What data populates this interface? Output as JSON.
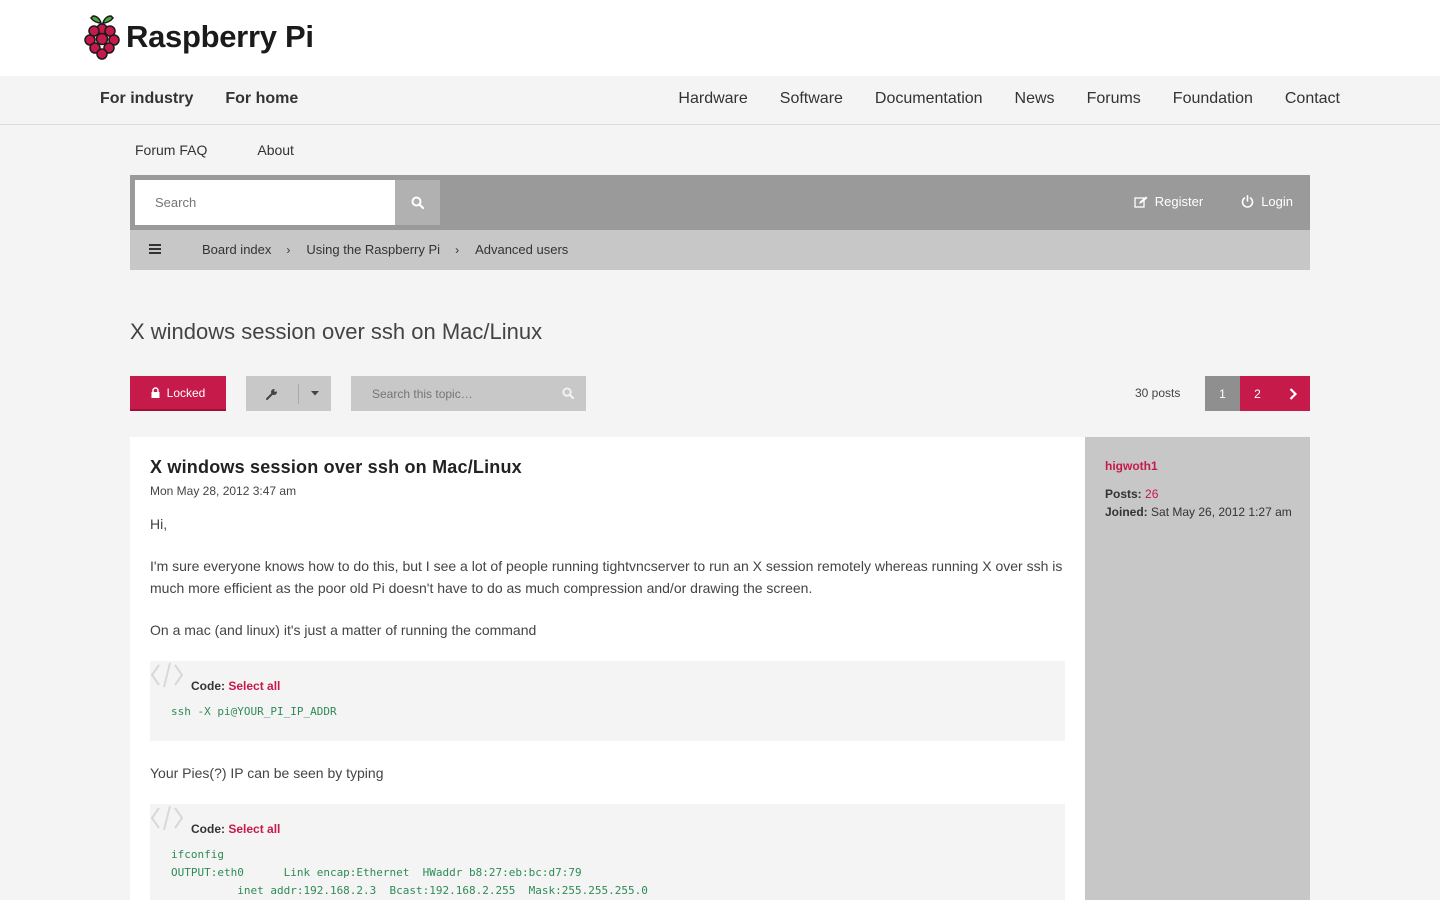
{
  "brand": {
    "name": "Raspberry Pi",
    "accent": "#c51a4a"
  },
  "main_nav": {
    "left": [
      "For industry",
      "For home"
    ],
    "right": [
      "Hardware",
      "Software",
      "Documentation",
      "News",
      "Forums",
      "Foundation",
      "Contact"
    ]
  },
  "forum_links": [
    "Forum FAQ",
    "About"
  ],
  "header": {
    "search_placeholder": "Search",
    "register": "Register",
    "login": "Login"
  },
  "breadcrumb": [
    "Board index",
    "Using the Raspberry Pi",
    "Advanced users"
  ],
  "topic": {
    "title": "X windows session over ssh on Mac/Linux",
    "locked_label": "Locked",
    "search_placeholder": "Search this topic…",
    "post_count": "30 posts",
    "pages": [
      "1",
      "2"
    ],
    "current_page": "1"
  },
  "post": {
    "title": "X windows session over ssh on Mac/Linux",
    "date": "Mon May 28, 2012 3:47 am",
    "p1": "Hi,",
    "p2": "I'm sure everyone knows how to do this, but I see a lot of people running tightvncserver to run an X session remotely whereas running X over ssh is much more efficient as the poor old Pi doesn't have to do as much compression and/or drawing the screen.",
    "p3": "On a mac (and linux) it's just a matter of running the command",
    "code_label": "Code:",
    "select_all": "Select all",
    "code1": "ssh -X pi@YOUR_PI_IP_ADDR",
    "p4": "Your Pies(?) IP can be seen by typing",
    "code2": "ifconfig\nOUTPUT:eth0      Link encap:Ethernet  HWaddr b8:27:eb:bc:d7:79\n          inet addr:192.168.2.3  Bcast:192.168.2.255  Mask:255.255.255.0"
  },
  "author": {
    "username": "higwoth1",
    "posts_label": "Posts:",
    "posts": "26",
    "joined_label": "Joined:",
    "joined": "Sat May 26, 2012 1:27 am"
  }
}
